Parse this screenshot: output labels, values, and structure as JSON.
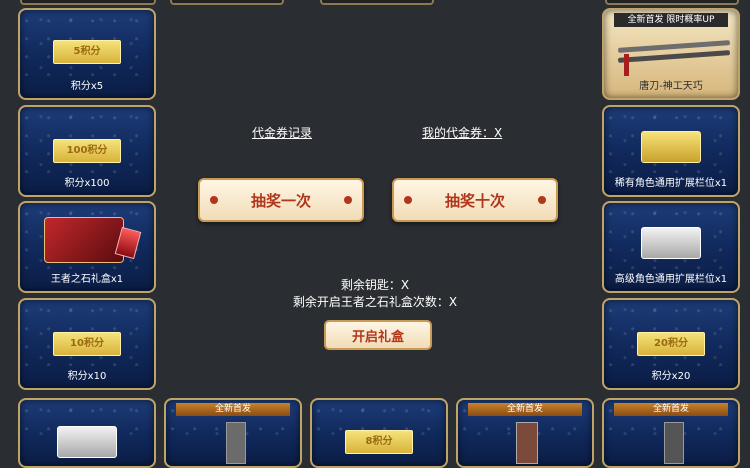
{
  "left_column": [
    {
      "label": "积分x5",
      "badge": "5积分"
    },
    {
      "label": "积分x100",
      "badge": "100积分"
    },
    {
      "label": "王者之石礼盒x1",
      "badge": ""
    },
    {
      "label": "积分x10",
      "badge": "10积分"
    }
  ],
  "right_column": [
    {
      "label": "唐刀-神工天巧",
      "tag": "全新首发 限时概率UP"
    },
    {
      "label": "稀有角色通用扩展栏位x1"
    },
    {
      "label": "高级角色通用扩展栏位x1"
    },
    {
      "label": "积分x20",
      "badge": "20积分"
    }
  ],
  "bottom_row": [
    {
      "tag": ""
    },
    {
      "tag": "全新首发"
    },
    {
      "badge": "8积分"
    },
    {
      "tag": "全新首发"
    },
    {
      "tag": "全新首发"
    }
  ],
  "center": {
    "voucher_record": "代金券记录",
    "my_voucher": "我的代金券：X",
    "draw_once": "抽奖一次",
    "draw_ten": "抽奖十次",
    "keys_left": "剩余钥匙：X",
    "boxes_left": "剩余开启王者之石礼盒次数：X",
    "open_box": "开启礼盒"
  },
  "colors": {
    "background": "#2a2d31",
    "card_border": "#bfa46a",
    "button_text": "#b0371c"
  }
}
